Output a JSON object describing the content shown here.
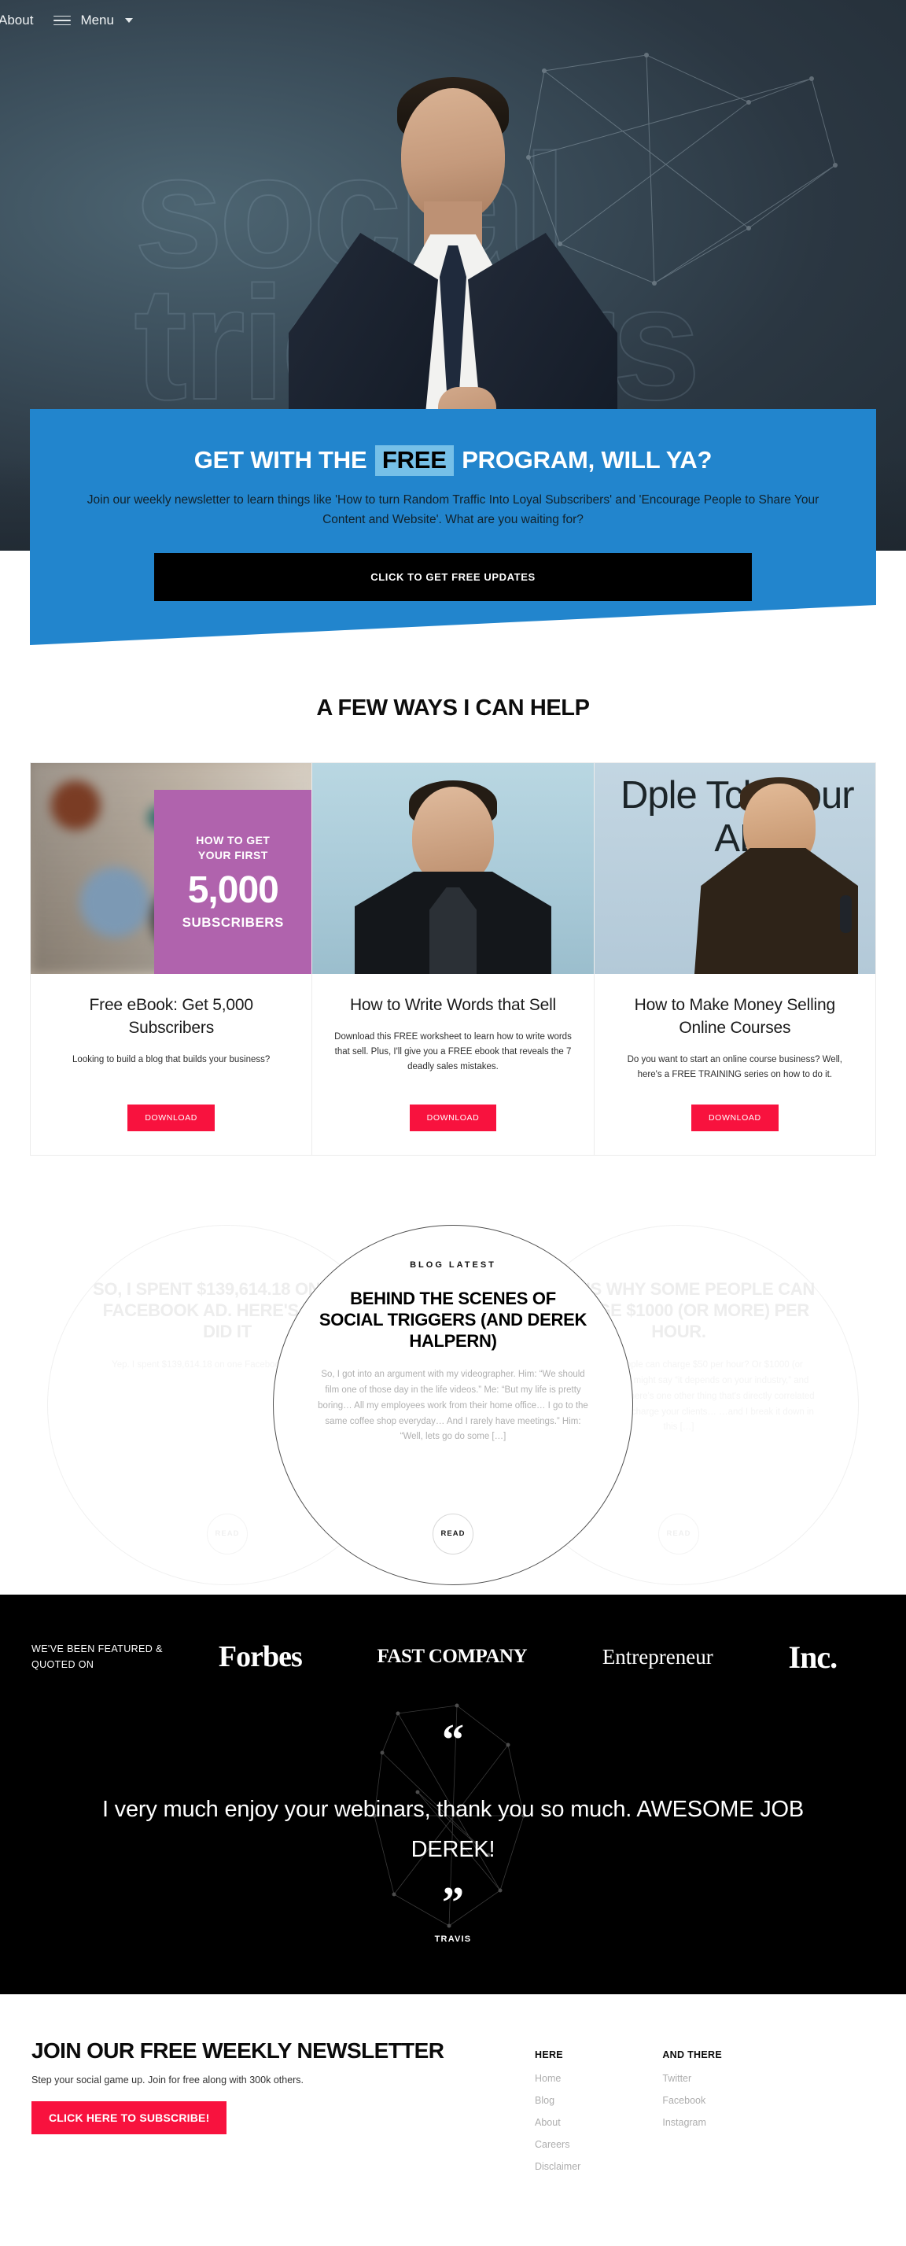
{
  "nav": {
    "about": "About",
    "menu": "Menu",
    "menu_icon": "hamburger-icon",
    "caret_icon": "chevron-down-icon"
  },
  "hero": {
    "watermark_line1": "social",
    "watermark_line2": "triggers",
    "figure_alt": "man-in-suit-adjusting-tie"
  },
  "cta": {
    "title_part1": "GET WITH THE",
    "title_highlight": "FREE",
    "title_part2": "PROGRAM, WILL YA?",
    "body": "Join our weekly newsletter to learn things like 'How to turn Random Traffic Into Loyal Subscribers' and 'Encourage People to Share Your Content and Website'. What are you waiting for?",
    "button": "CLICK TO GET FREE UPDATES",
    "bg_color": "#2285cd",
    "highlight_color": "#76c0e8",
    "button_color": "#000000"
  },
  "help": {
    "heading": "A FEW WAYS I CAN HELP",
    "cards": [
      {
        "overlay_line1": "HOW TO GET",
        "overlay_line2": "YOUR FIRST",
        "overlay_number": "5,000",
        "overlay_line3": "SUBSCRIBERS",
        "title": "Free eBook: Get 5,000 Subscribers",
        "desc": "Looking to build a blog that builds your business?",
        "button": "DOWNLOAD"
      },
      {
        "title": "How to Write Words that Sell",
        "desc": "Download this FREE worksheet to learn how to write words that sell. Plus, I'll give you a FREE ebook that reveals the 7 deadly sales mistakes.",
        "button": "DOWNLOAD"
      },
      {
        "image_text": "Dple Tch Cour AL",
        "title": "How to Make Money Selling Online Courses",
        "desc": "Do you want to start an online course business? Well, here's a FREE TRAINING series on how to do it.",
        "button": "DOWNLOAD"
      }
    ],
    "button_color": "#f8123e",
    "overlay_color": "#b063ad"
  },
  "blog": {
    "posts": [
      {
        "kicker": "",
        "title": "SO, I SPENT $139,614.18 ON ONE FACEBOOK AD. HERE'S WHY I DID IT",
        "excerpt": "Yep. I spent $139,614.18 on one Facebook ad. Read this!",
        "read": "READ"
      },
      {
        "kicker": "BLOG LATEST",
        "title": "BEHIND THE SCENES OF SOCIAL TRIGGERS (AND DEREK HALPERN)",
        "excerpt": "So, I got into an argument with my videographer. Him: “We should film one of those day in the life videos.” Me: “But my life is pretty boring… All my employees work from their home office… I go to the same coffee shop everyday… And I rarely have meetings.” Him: “Well, lets go do some […]",
        "read": "READ"
      },
      {
        "kicker": "",
        "title": "THIS IS WHY SOME PEOPLE CAN CHARGE $1000 (OR MORE) PER HOUR.",
        "excerpt": "Why is it some people can charge $50 per hour? Or $1000 (or more) per hour? You might say “it depends on your industry,” and that's partly true, but there's one other thing that's directly correlated to how much you can charge your clients… …and I break it down in this […]",
        "read": "READ"
      }
    ]
  },
  "featured": {
    "label": "WE'VE BEEN FEATURED & QUOTED ON",
    "logos": [
      "Forbes",
      "FAST COMPANY",
      "Entrepreneur",
      "Inc."
    ]
  },
  "testimonial": {
    "open_quote": "“",
    "close_quote": "”",
    "text": "I very much enjoy your webinars, thank you so much. AWESOME JOB DEREK!",
    "author": "TRAVIS"
  },
  "footer": {
    "heading": "JOIN OUR FREE WEEKLY NEWSLETTER",
    "sub": "Step your social game up. Join for free along with 300k others.",
    "button": "CLICK HERE TO SUBSCRIBE!",
    "col1_title": "HERE",
    "col1_links": [
      "Home",
      "Blog",
      "About",
      "Careers",
      "Disclaimer"
    ],
    "col2_title": "AND THERE",
    "col2_links": [
      "Twitter",
      "Facebook",
      "Instagram"
    ]
  }
}
